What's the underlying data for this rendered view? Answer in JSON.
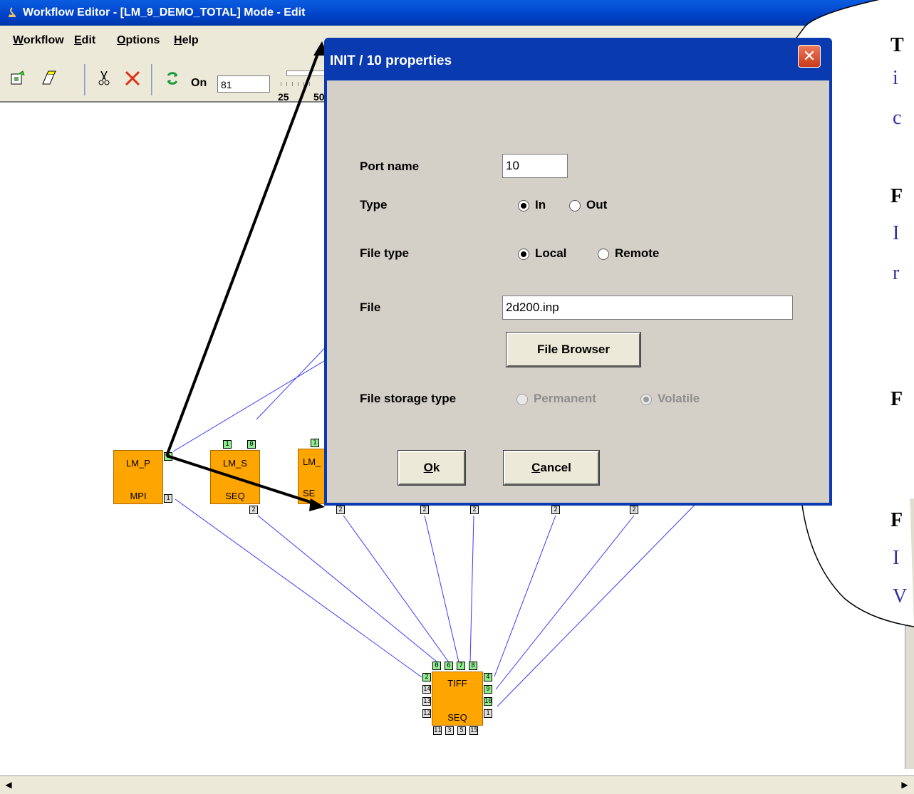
{
  "window": {
    "title": "Workflow Editor - [LM_9_DEMO_TOTAL] Mode - Edit"
  },
  "menu": [
    {
      "mnemonic": "W",
      "rest": "orkflow"
    },
    {
      "mnemonic": "E",
      "rest": "dit"
    },
    {
      "mnemonic": "O",
      "rest": "ptions"
    },
    {
      "mnemonic": "H",
      "rest": "elp"
    }
  ],
  "toolbar": {
    "on_label": "On",
    "on_value": "81",
    "slider_ticks": [
      "25",
      "50"
    ]
  },
  "nodes": [
    {
      "id": "lm_p",
      "top": "LM_P",
      "bottom": "MPI"
    },
    {
      "id": "lm_s",
      "top": "LM_S",
      "bottom": "SEQ"
    },
    {
      "id": "lm_3",
      "top": "LM_",
      "bottom": "SE"
    },
    {
      "id": "tiff",
      "top": "TIFF",
      "bottom": "SEQ"
    }
  ],
  "ports": {
    "lm_p_out": "1",
    "lm_p_in": "0",
    "lm_s_top": [
      "1",
      "0"
    ],
    "lm_s_bottom": "2",
    "lm_3_top": "1",
    "lm_3_bottom": "2",
    "bottom_row": [
      "2",
      "2",
      "2",
      "2"
    ],
    "tiff_top": [
      "0",
      "6",
      "7",
      "8"
    ],
    "tiff_left": [
      "2",
      "14",
      "13",
      "12"
    ],
    "tiff_right": [
      "4",
      "9",
      "10",
      "1"
    ],
    "tiff_bottom": [
      "11",
      "3",
      "5",
      "15"
    ]
  },
  "dialog": {
    "title": "INIT / 10 properties",
    "port_name_label": "Port name",
    "port_name_value": "10",
    "type_label": "Type",
    "type_in": "In",
    "type_out": "Out",
    "type_selected": "In",
    "file_type_label": "File type",
    "file_type_local": "Local",
    "file_type_remote": "Remote",
    "file_type_selected": "Local",
    "file_label": "File",
    "file_value": "2d200.inp",
    "file_browser_button": "File Browser",
    "storage_label": "File storage type",
    "storage_permanent": "Permanent",
    "storage_volatile": "Volatile",
    "storage_selected": "Volatile",
    "ok_mnemonic": "O",
    "ok_rest": "k",
    "cancel_mnemonic": "C",
    "cancel_rest": "ancel"
  },
  "callout": {
    "lines": [
      "T",
      "i",
      "c",
      "F",
      "I",
      "r",
      "F",
      "F",
      "I",
      "V"
    ]
  },
  "colors": {
    "node": "#ffa500",
    "port_connected": "#90ee90",
    "edge": "#3a3aff",
    "titlebar": "#0042c8",
    "dialog_body": "#d4d0c8"
  }
}
